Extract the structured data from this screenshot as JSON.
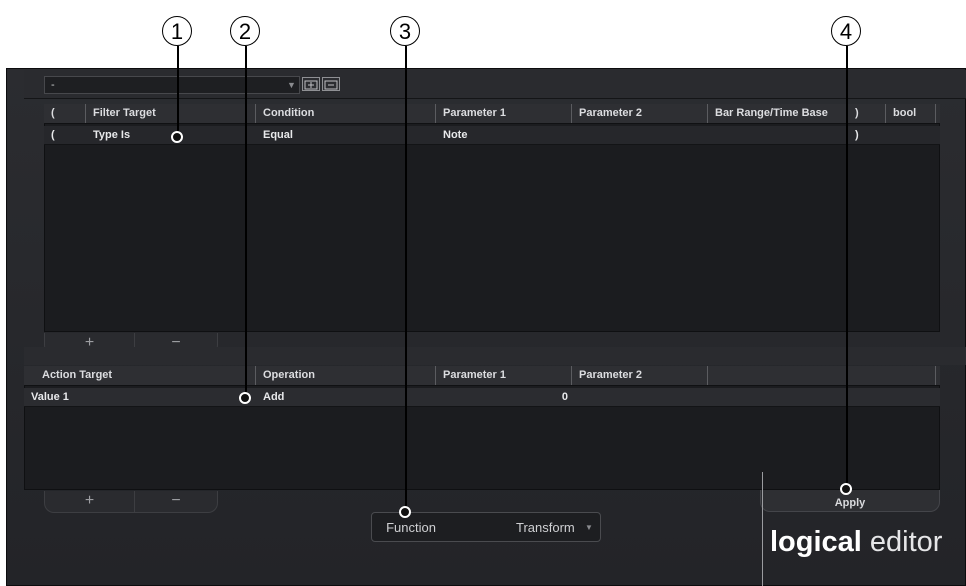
{
  "callouts": [
    "1",
    "2",
    "3",
    "4"
  ],
  "preset": {
    "value": "-",
    "buttons": [
      "add-preset-icon",
      "remove-preset-icon"
    ]
  },
  "filter_table": {
    "columns": [
      "(",
      "Filter Target",
      "Condition",
      "Parameter 1",
      "Parameter 2",
      "Bar Range/Time Base",
      ")",
      "bool"
    ],
    "rows": [
      {
        "open": "(",
        "target": "Type Is",
        "condition": "Equal",
        "param1": "Note",
        "param2": "",
        "range": "",
        "close": ")",
        "bool": ""
      }
    ],
    "add_label": "+",
    "remove_label": "−"
  },
  "action_table": {
    "columns": [
      "Action Target",
      "Operation",
      "Parameter 1",
      "Parameter 2",
      ""
    ],
    "rows": [
      {
        "target": "Value 1",
        "operation": "Add",
        "param1": "0",
        "param2": ""
      }
    ],
    "add_label": "+",
    "remove_label": "−"
  },
  "apply_label": "Apply",
  "function": {
    "label": "Function",
    "value": "Transform"
  },
  "logo": {
    "bold": "logical",
    "light": " editor"
  }
}
